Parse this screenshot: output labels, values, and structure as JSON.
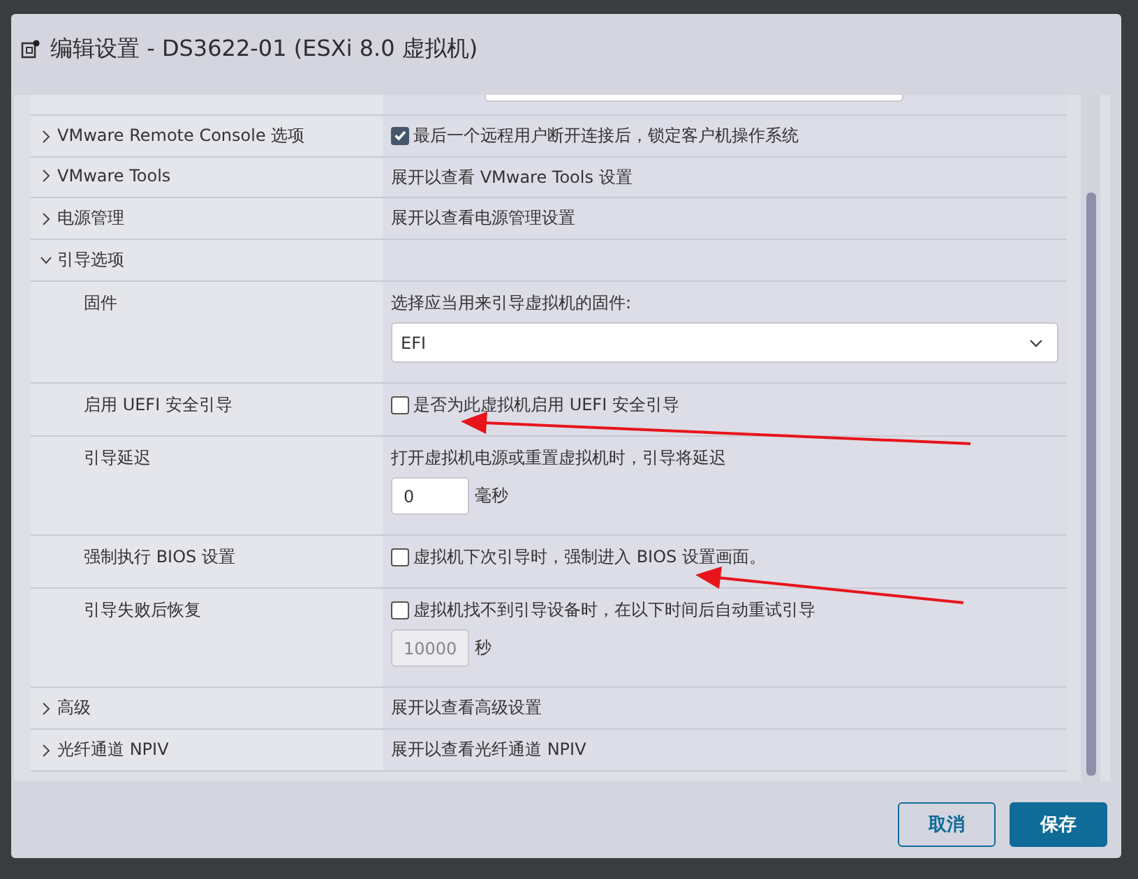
{
  "window": {
    "title": "编辑设置 - DS3622-01 (ESXi 8.0 虚拟机)"
  },
  "rows": [
    {
      "kind": "group",
      "label": "VMware Remote Console 选项",
      "expanded": false,
      "content": [
        {
          "kind": "checkbox",
          "checked": true,
          "label": "最后一个远程用户断开连接后，锁定客户机操作系统"
        }
      ]
    },
    {
      "kind": "group",
      "label": "VMware Tools",
      "expanded": false,
      "content": [
        {
          "kind": "text",
          "text": "展开以查看 VMware Tools 设置"
        }
      ]
    },
    {
      "kind": "group",
      "label": "电源管理",
      "expanded": false,
      "content": [
        {
          "kind": "text",
          "text": "展开以查看电源管理设置"
        }
      ]
    },
    {
      "kind": "group",
      "label": "引导选项",
      "expanded": true,
      "content": []
    },
    {
      "kind": "option",
      "label": "固件",
      "content": [
        {
          "kind": "text",
          "text": "选择应当用来引导虚拟机的固件:"
        },
        {
          "kind": "select",
          "value": "EFI"
        }
      ]
    },
    {
      "kind": "option",
      "label": "启用 UEFI 安全引导",
      "content": [
        {
          "kind": "checkbox",
          "checked": false,
          "label": "是否为此虚拟机启用 UEFI 安全引导"
        }
      ]
    },
    {
      "kind": "option",
      "label": "引导延迟",
      "content": [
        {
          "kind": "text",
          "text": "打开虚拟机电源或重置虚拟机时，引导将延迟"
        },
        {
          "kind": "number",
          "value": "0",
          "unit": "毫秒",
          "disabled": false
        }
      ]
    },
    {
      "kind": "option",
      "label": "强制执行 BIOS 设置",
      "content": [
        {
          "kind": "checkbox",
          "checked": false,
          "label": "虚拟机下次引导时，强制进入 BIOS 设置画面。"
        }
      ]
    },
    {
      "kind": "option",
      "label": "引导失败后恢复",
      "content": [
        {
          "kind": "checkbox",
          "checked": false,
          "label": "虚拟机找不到引导设备时，在以下时间后自动重试引导"
        },
        {
          "kind": "number",
          "value": "10000",
          "unit": "秒",
          "disabled": true
        }
      ]
    },
    {
      "kind": "group",
      "label": "高级",
      "expanded": false,
      "content": [
        {
          "kind": "text",
          "text": "展开以查看高级设置"
        }
      ]
    },
    {
      "kind": "group",
      "label": "光纤通道 NPIV",
      "expanded": false,
      "content": [
        {
          "kind": "text",
          "text": "展开以查看光纤通道 NPIV"
        }
      ]
    }
  ],
  "buttons": [
    {
      "label": "取消",
      "kind": "secondary"
    },
    {
      "label": "保存",
      "kind": "primary"
    }
  ]
}
